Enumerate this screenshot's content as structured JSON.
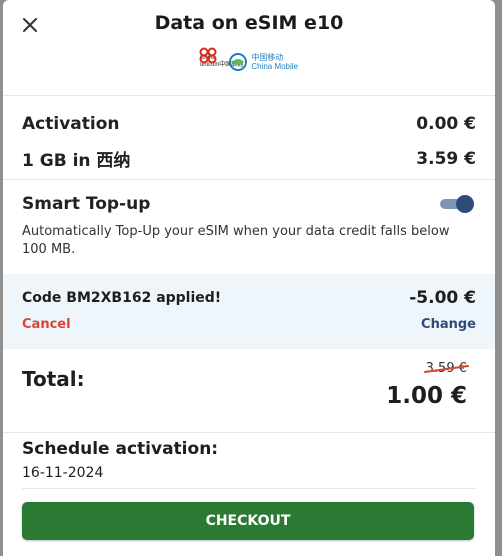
{
  "header": {
    "title": "Data on eSIM e10",
    "close_icon": "close-icon",
    "logos": {
      "china_unicom": {
        "line1": "China",
        "line2": "unicom中国联通"
      },
      "china_mobile": {
        "line1": "中国移动",
        "line2": "China Mobile"
      }
    }
  },
  "lines": [
    {
      "label": "Activation",
      "value": "0.00 €"
    },
    {
      "label": "1 GB in 西纳",
      "value": "3.59 €"
    }
  ],
  "smart_topup": {
    "title": "Smart Top-up",
    "enabled": true,
    "description": "Automatically Top-Up your eSIM when your data credit falls below 100 MB."
  },
  "promo": {
    "message": "Code BM2XB162 applied!",
    "discount": "-5.00 €",
    "cancel_label": "Cancel",
    "change_label": "Change"
  },
  "total": {
    "label": "Total:",
    "old_price": "3.59 €",
    "new_price": "1.00 €"
  },
  "schedule": {
    "label": "Schedule activation:",
    "date": "16-11-2024"
  },
  "checkout_label": "CHECKOUT",
  "colors": {
    "checkout_green": "#2a7a33",
    "cancel_red": "#d9443b",
    "link_blue": "#2d4d78",
    "promo_bg": "#eef5fb"
  }
}
